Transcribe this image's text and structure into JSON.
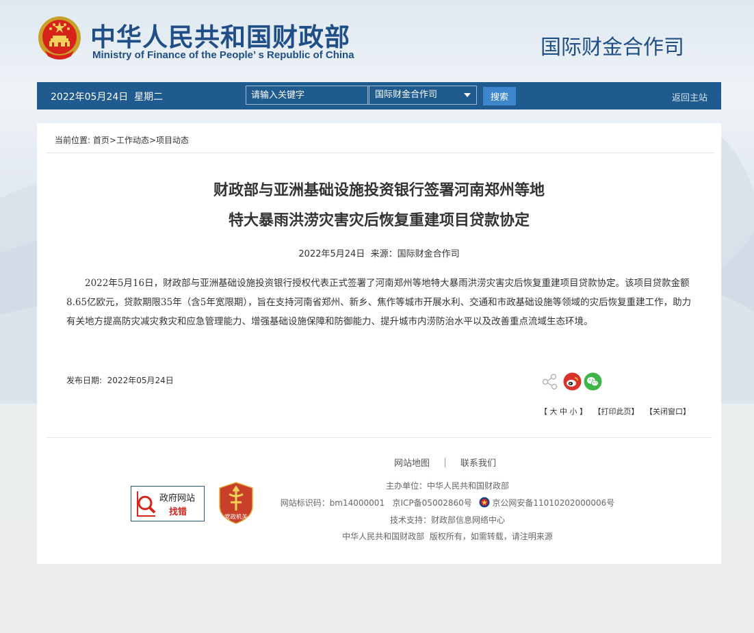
{
  "header": {
    "site_title_cn": "中华人民共和国财政部",
    "site_title_en": "Ministry of Finance of the People’ s Republic of China",
    "dept_name": "国际财金合作司"
  },
  "navbar": {
    "date": "2022年05月24日  星期二",
    "search_placeholder": "请输入关键字",
    "select_value": "国际财金合作司",
    "search_button": "搜索",
    "home_link": "返回主站"
  },
  "breadcrumb": {
    "prefix": "当前位置:",
    "items": [
      "首页",
      "工作动态",
      "项目动态"
    ],
    "separator": ">"
  },
  "article": {
    "title_line1": "财政部与亚洲基础设施投资银行签署河南郑州等地",
    "title_line2": "特大暴雨洪涝灾害灾后恢复重建项目贷款协定",
    "meta": "2022年5月24日  来源：国际财金合作司",
    "body": "2022年5月16日，财政部与亚洲基础设施投资银行授权代表正式签署了河南郑州等地特大暴雨洪涝灾害灾后恢复重建项目贷款协定。该项目贷款金额8.65亿欧元，贷款期限35年（含5年宽限期），旨在支持河南省郑州、新乡、焦作等城市开展水利、交通和市政基础设施等领域的灾后恢复重建工作，助力有关地方提高防灾减灾救灾和应急管理能力、增强基础设施保障和防御能力、提升城市内涝防治水平以及改善重点流域生态环境。",
    "publish_date": "发布日期:  2022年05月24日"
  },
  "share": {
    "icons": [
      "share-icon",
      "weibo-icon",
      "wechat-icon"
    ],
    "colors": {
      "weibo": "#d9332c",
      "wechat": "#3fb449",
      "share": "#b5b5b5"
    }
  },
  "text_options": {
    "size": "【 大 中 小 】",
    "print": "【打印此页】",
    "close": "【关闭窗口】"
  },
  "footer": {
    "sitemap": "网站地图",
    "contact": "联系我们",
    "badge_gov_line1": "政府网站",
    "badge_gov_line2": "找错",
    "badge_party": "党政机关",
    "sponsor": "主办单位：中华人民共和国财政部",
    "site_id": "网站标识码：bm14000001   京ICP备05002860号",
    "police_record": "京公网安备11010202000006号",
    "tech_support": "技术支持：财政部信息网络中心",
    "copyright": "中华人民共和国财政部  版权所有，如需转载，请注明来源"
  },
  "colors": {
    "brand_blue": "#1f4f86",
    "nav_bg": "#1f5b8e",
    "search_btn": "#3d86cc"
  }
}
